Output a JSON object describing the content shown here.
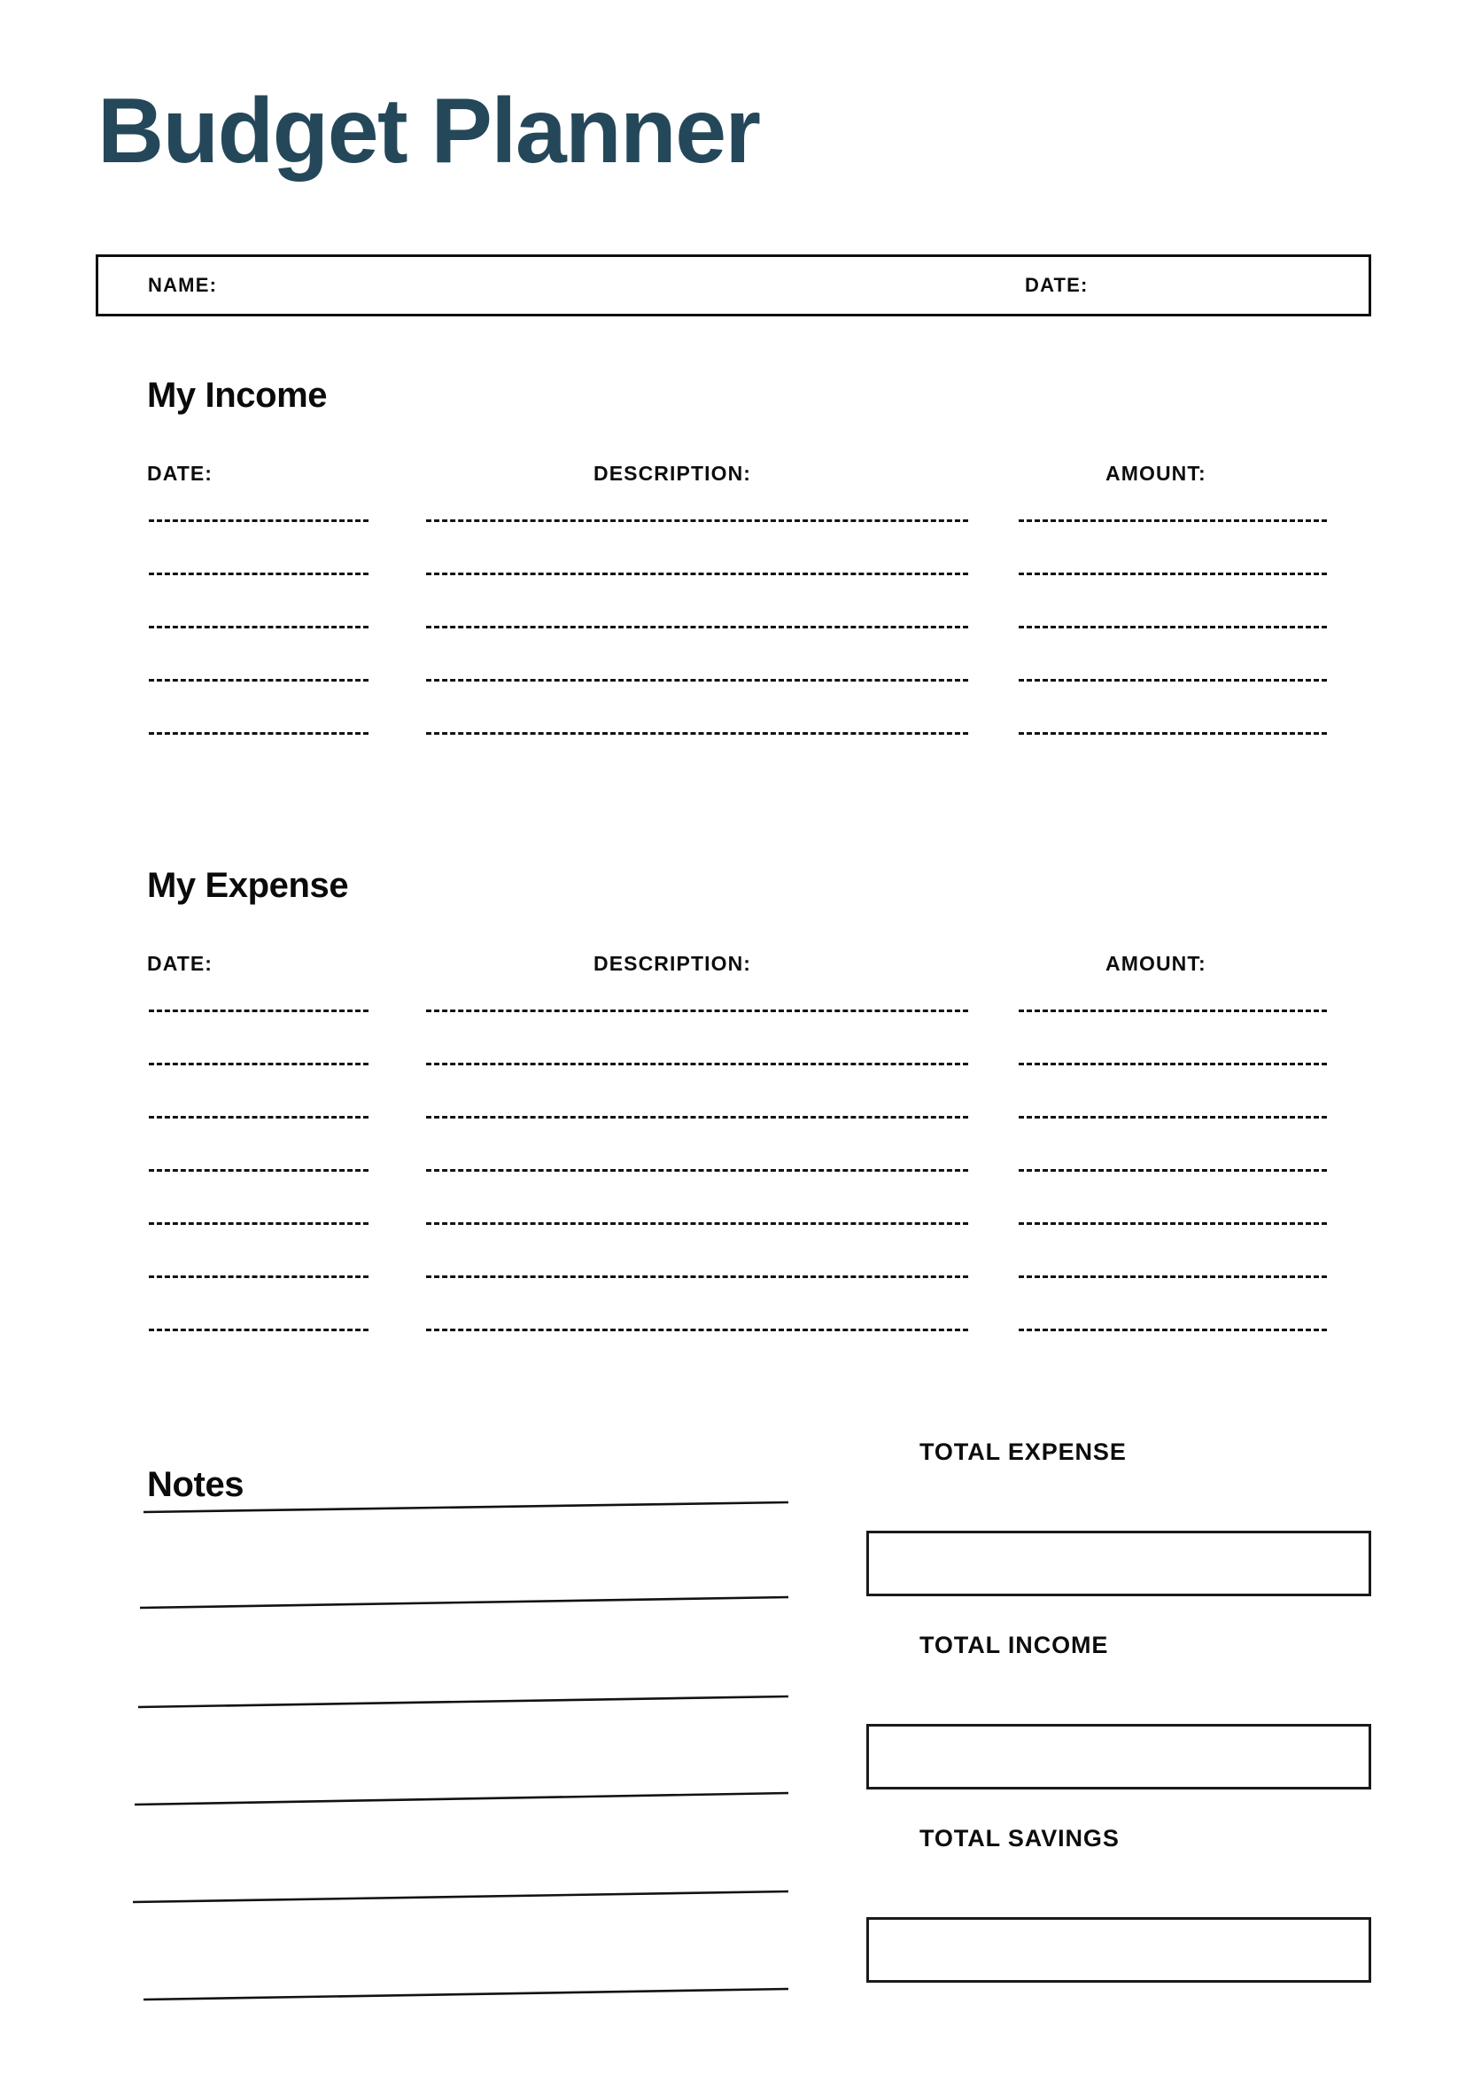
{
  "document": {
    "title": "Budget Planner",
    "title_color": "#24485a",
    "ink_color": "#0d0d0e",
    "page_background": "#ffffff"
  },
  "header_fields": {
    "name_label": "NAME:",
    "name_value": "",
    "date_label": "DATE:",
    "date_value": ""
  },
  "income": {
    "heading": "My Income",
    "columns": {
      "date": "DATE:",
      "description": "DESCRIPTION:",
      "amount": "AMOUNT:"
    },
    "row_count": 5,
    "rows": [
      {
        "date": "",
        "description": "",
        "amount": ""
      },
      {
        "date": "",
        "description": "",
        "amount": ""
      },
      {
        "date": "",
        "description": "",
        "amount": ""
      },
      {
        "date": "",
        "description": "",
        "amount": ""
      },
      {
        "date": "",
        "description": "",
        "amount": ""
      }
    ]
  },
  "expense": {
    "heading": "My Expense",
    "columns": {
      "date": "DATE:",
      "description": "DESCRIPTION:",
      "amount": "AMOUNT:"
    },
    "row_count": 7,
    "rows": [
      {
        "date": "",
        "description": "",
        "amount": ""
      },
      {
        "date": "",
        "description": "",
        "amount": ""
      },
      {
        "date": "",
        "description": "",
        "amount": ""
      },
      {
        "date": "",
        "description": "",
        "amount": ""
      },
      {
        "date": "",
        "description": "",
        "amount": ""
      },
      {
        "date": "",
        "description": "",
        "amount": ""
      },
      {
        "date": "",
        "description": "",
        "amount": ""
      }
    ]
  },
  "notes": {
    "heading": "Notes",
    "line_count": 6,
    "lines": [
      "",
      "",
      "",
      "",
      "",
      ""
    ]
  },
  "totals": [
    {
      "label": "TOTAL EXPENSE",
      "value": ""
    },
    {
      "label": "TOTAL INCOME",
      "value": ""
    },
    {
      "label": "TOTAL SAVINGS",
      "value": ""
    }
  ]
}
